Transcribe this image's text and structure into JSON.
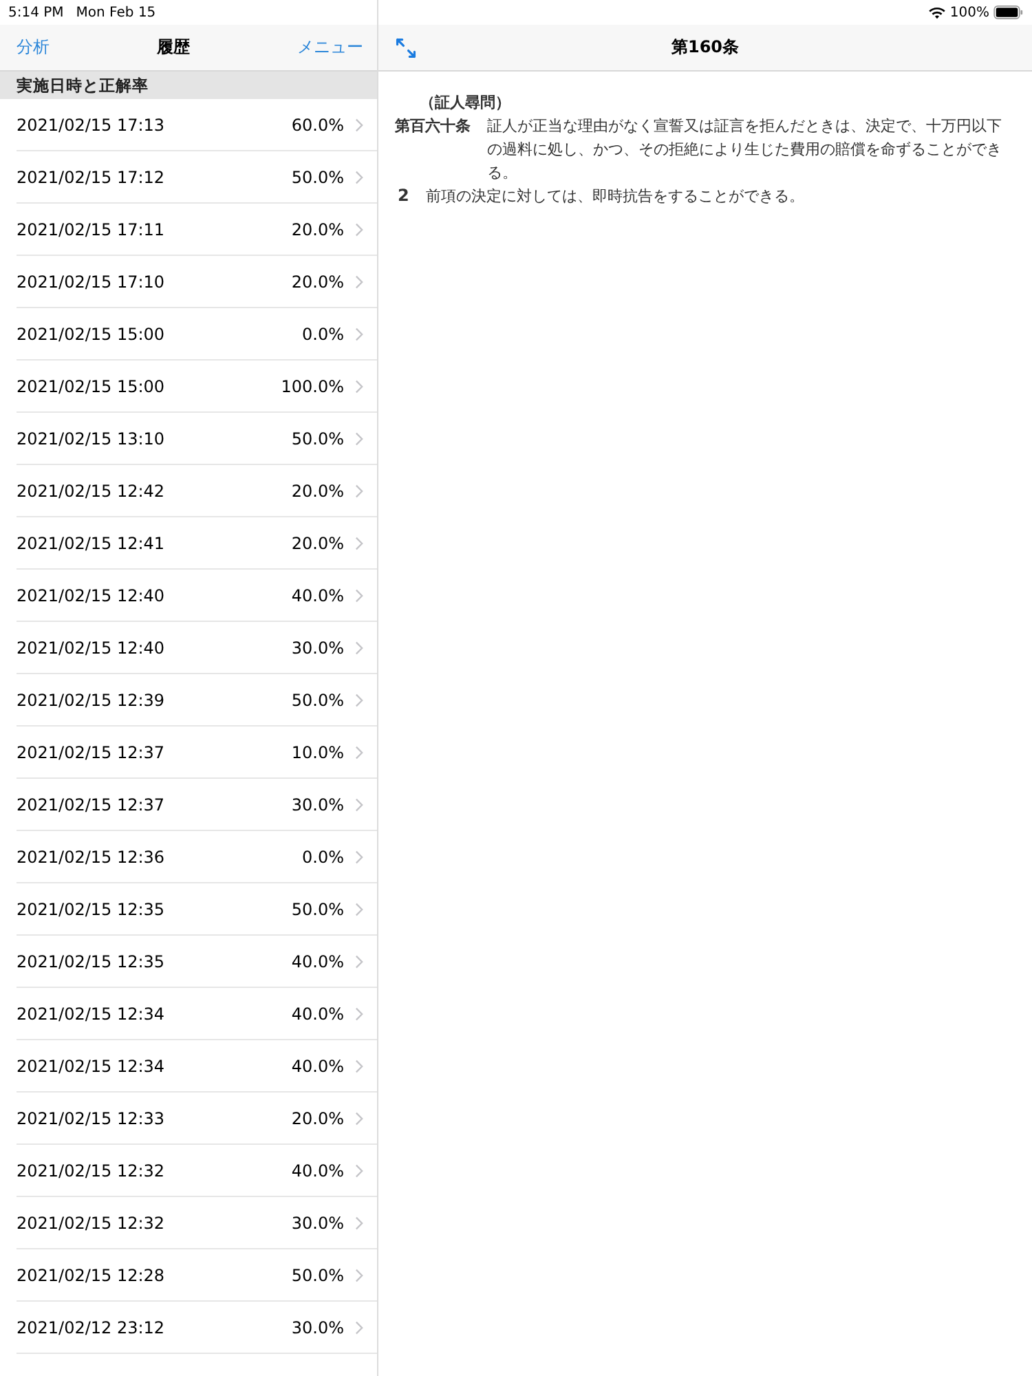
{
  "status_bar": {
    "time": "5:14 PM",
    "date": "Mon Feb 15",
    "battery": "100%"
  },
  "list_panel": {
    "left_button": "分析",
    "title": "履歴",
    "right_button": "メニュー",
    "section_header": "実施日時と正解率",
    "rows": [
      {
        "datetime": "2021/02/15 17:13",
        "score": "60.0%"
      },
      {
        "datetime": "2021/02/15 17:12",
        "score": "50.0%"
      },
      {
        "datetime": "2021/02/15 17:11",
        "score": "20.0%"
      },
      {
        "datetime": "2021/02/15 17:10",
        "score": "20.0%"
      },
      {
        "datetime": "2021/02/15 15:00",
        "score": "0.0%"
      },
      {
        "datetime": "2021/02/15 15:00",
        "score": "100.0%"
      },
      {
        "datetime": "2021/02/15 13:10",
        "score": "50.0%"
      },
      {
        "datetime": "2021/02/15 12:42",
        "score": "20.0%"
      },
      {
        "datetime": "2021/02/15 12:41",
        "score": "20.0%"
      },
      {
        "datetime": "2021/02/15 12:40",
        "score": "40.0%"
      },
      {
        "datetime": "2021/02/15 12:40",
        "score": "30.0%"
      },
      {
        "datetime": "2021/02/15 12:39",
        "score": "50.0%"
      },
      {
        "datetime": "2021/02/15 12:37",
        "score": "10.0%"
      },
      {
        "datetime": "2021/02/15 12:37",
        "score": "30.0%"
      },
      {
        "datetime": "2021/02/15 12:36",
        "score": "0.0%"
      },
      {
        "datetime": "2021/02/15 12:35",
        "score": "50.0%"
      },
      {
        "datetime": "2021/02/15 12:35",
        "score": "40.0%"
      },
      {
        "datetime": "2021/02/15 12:34",
        "score": "40.0%"
      },
      {
        "datetime": "2021/02/15 12:34",
        "score": "40.0%"
      },
      {
        "datetime": "2021/02/15 12:33",
        "score": "20.0%"
      },
      {
        "datetime": "2021/02/15 12:32",
        "score": "40.0%"
      },
      {
        "datetime": "2021/02/15 12:32",
        "score": "30.0%"
      },
      {
        "datetime": "2021/02/15 12:28",
        "score": "50.0%"
      },
      {
        "datetime": "2021/02/12 23:12",
        "score": "30.0%"
      }
    ]
  },
  "detail_panel": {
    "title": "第160条",
    "caption": "（証人尋問）",
    "article": {
      "number": "第百六十条",
      "text": "証人が正当な理由がなく宣誓又は証言を拒んだときは、決定で、十万円以下の過料に処し、かつ、その拒絶により生じた費用の賠償を命ずることができる。"
    },
    "paragraphs": [
      {
        "number": "2",
        "text": "前項の決定に対しては、即時抗告をすることができる。"
      }
    ]
  }
}
